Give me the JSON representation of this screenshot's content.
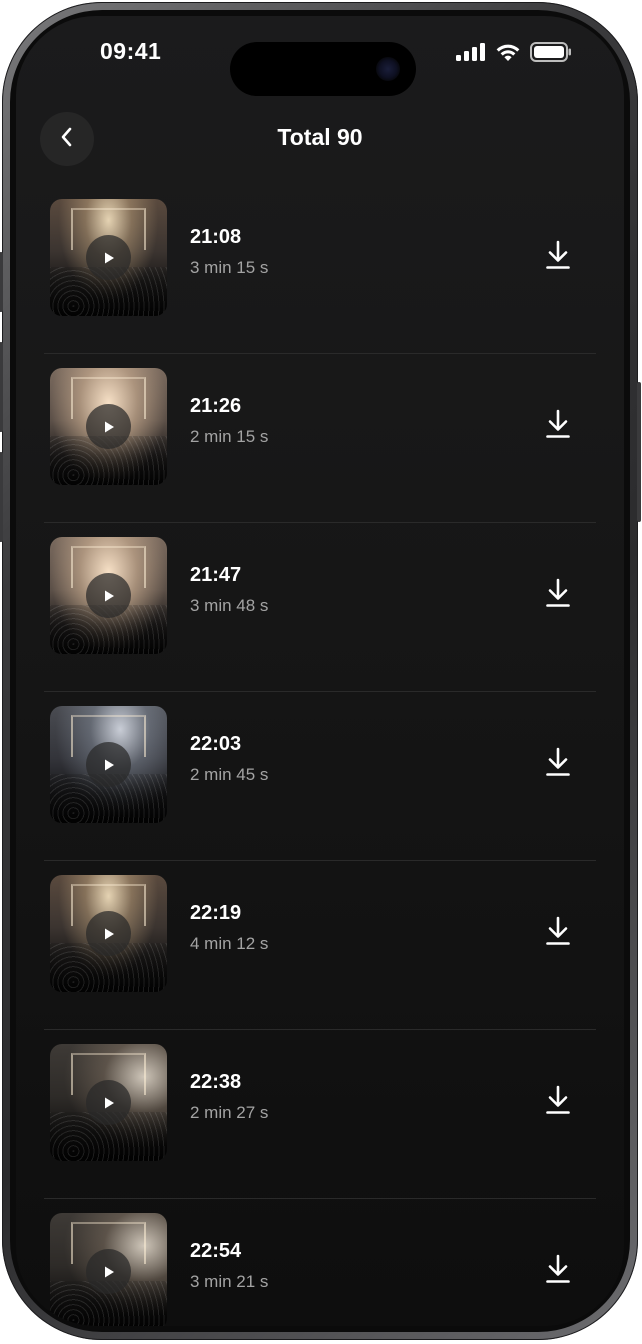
{
  "status_bar": {
    "time": "09:41",
    "icons": [
      "cellular-signal-icon",
      "wifi-icon",
      "battery-icon"
    ]
  },
  "header": {
    "back_icon": "chevron-left-icon",
    "title": "Total 90"
  },
  "videos": [
    {
      "time": "21:08",
      "duration": "3 min 15 s"
    },
    {
      "time": "21:26",
      "duration": "2 min 15 s"
    },
    {
      "time": "21:47",
      "duration": "3 min 48 s"
    },
    {
      "time": "22:03",
      "duration": "2 min 45 s"
    },
    {
      "time": "22:19",
      "duration": "4 min 12 s"
    },
    {
      "time": "22:38",
      "duration": "2 min 27 s"
    },
    {
      "time": "22:54",
      "duration": "3 min 21 s"
    }
  ],
  "row_icons": {
    "play": "play-icon",
    "download": "download-icon"
  },
  "colors": {
    "background": "#161616",
    "primary_text": "#ffffff",
    "secondary_text": "#a3a3a3",
    "divider": "#2a2a2a",
    "back_button_bg": "#262626"
  }
}
